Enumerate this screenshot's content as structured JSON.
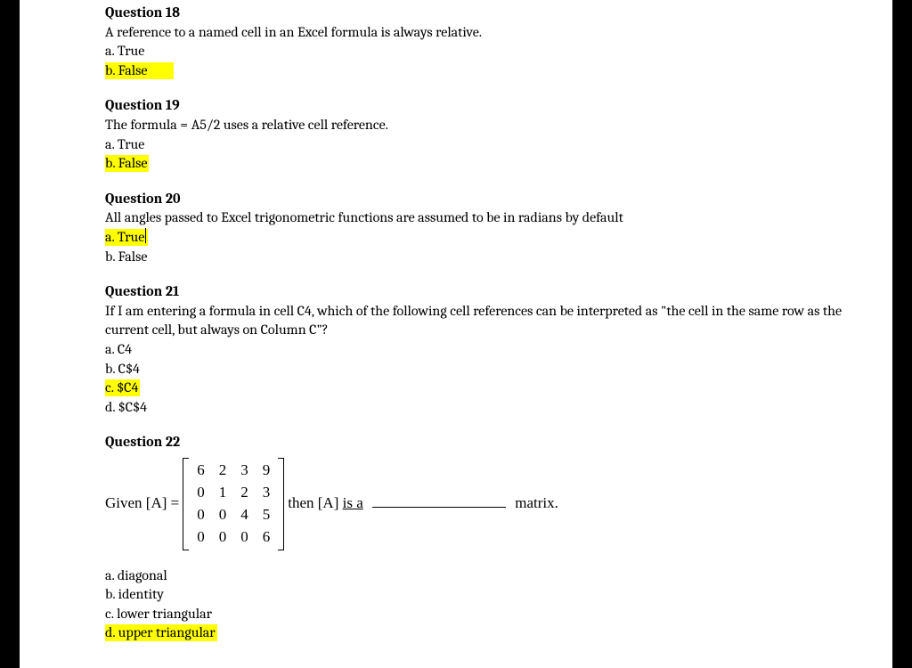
{
  "q18": {
    "title": "Question 18",
    "prompt": "A reference to a named cell in an Excel formula is always relative.",
    "a": "a. True",
    "b": "b. False"
  },
  "q19": {
    "title": "Question 19",
    "prompt": "The formula = A5/2 uses a relative cell reference.",
    "a": "a. True",
    "b": "b. False"
  },
  "q20": {
    "title": "Question 20",
    "prompt": "All angles passed to Excel trigonometric functions are assumed to be in radians by default",
    "a": "a. True",
    "b": "b. False"
  },
  "q21": {
    "title": "Question 21",
    "prompt": "If I am entering a formula in cell C4, which of the following cell references can be interpreted as \"the cell in the same row as the current cell, but always on Column C\"?",
    "a": "a. C4",
    "b": "b. C$4",
    "c": "c. $C4",
    "d": "d. $C$4"
  },
  "q22": {
    "title": "Question 22",
    "given": "Given [A] =",
    "thentext": "then [A] ",
    "isa": "is  a",
    "trailing": " matrix.",
    "a": "a. diagonal",
    "b": "b. identity",
    "c": "c. lower triangular",
    "d": "d. upper triangular"
  },
  "chart_data": {
    "type": "table",
    "title": "Matrix A",
    "rows": [
      [
        6,
        2,
        3,
        9
      ],
      [
        0,
        1,
        2,
        3
      ],
      [
        0,
        0,
        4,
        5
      ],
      [
        0,
        0,
        0,
        6
      ]
    ]
  }
}
